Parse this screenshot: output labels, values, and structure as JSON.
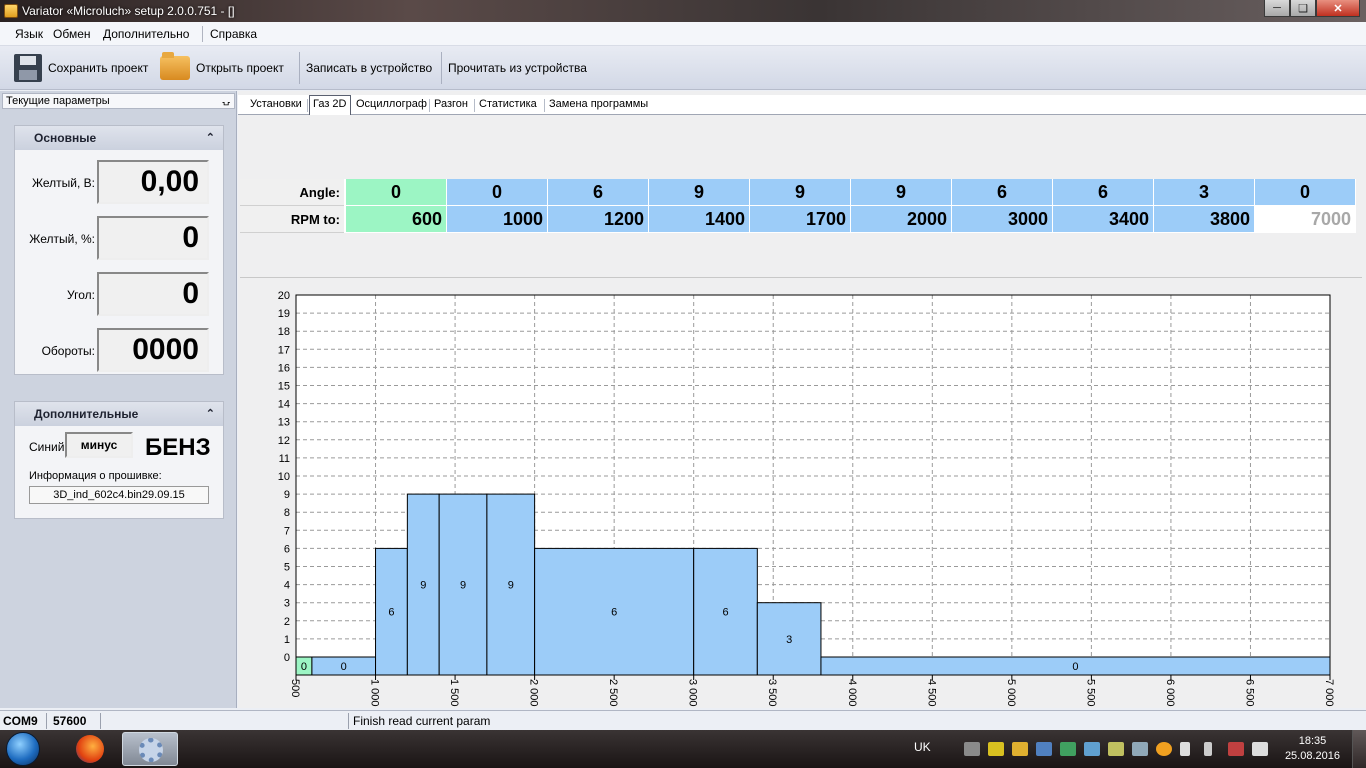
{
  "window": {
    "title": "Variator «Microluch» setup 2.0.0.751 - []"
  },
  "menu": [
    "Язык",
    "Обмен",
    "Дополнительно",
    "Справка"
  ],
  "toolbar": {
    "save": "Сохранить проект",
    "open": "Открыть проект",
    "write": "Записать в устройство",
    "read": "Прочитать из устройства"
  },
  "left_panel": {
    "title": "Текущие параметры",
    "main": {
      "title": "Основные",
      "rows": [
        {
          "label": "Желтый, В:",
          "value": "0,00"
        },
        {
          "label": "Желтый, %:",
          "value": "0"
        },
        {
          "label": "Угол:",
          "value": "0"
        },
        {
          "label": "Обороты:",
          "value": "0000"
        }
      ]
    },
    "extra": {
      "title": "Дополнительные",
      "blue_label": "Синий:",
      "blue_value": "минус",
      "fuel": "БЕНЗ",
      "fw_label": "Информация о прошивке:",
      "fw_value": "3D_ind_602c4.bin29.09.15"
    }
  },
  "tabs": [
    "Установки",
    "Газ 2D",
    "Осциллограф",
    "Разгон",
    "Статистика",
    "Замена программы"
  ],
  "active_tab": 1,
  "table": {
    "angle_label": "Angle:",
    "rpm_label": "RPM to:",
    "angle": [
      "0",
      "0",
      "6",
      "9",
      "9",
      "9",
      "6",
      "6",
      "3",
      "0"
    ],
    "rpm": [
      "600",
      "1000",
      "1200",
      "1400",
      "1700",
      "2000",
      "3000",
      "3400",
      "3800",
      "7000"
    ]
  },
  "chart_data": {
    "type": "bar",
    "x_ticks": [
      "500",
      "1 000",
      "1 500",
      "2 000",
      "2 500",
      "3 000",
      "3 500",
      "4 000",
      "4 500",
      "5 000",
      "5 500",
      "6 000",
      "6 500",
      "7 000"
    ],
    "xlim": [
      500,
      7000
    ],
    "ylim": [
      0,
      20
    ],
    "y_ticks": [
      "0",
      "1",
      "2",
      "3",
      "4",
      "5",
      "6",
      "7",
      "8",
      "9",
      "10",
      "11",
      "12",
      "13",
      "14",
      "15",
      "16",
      "17",
      "18",
      "19",
      "20"
    ],
    "bins": [
      {
        "from": 500,
        "to": 600,
        "value": 0,
        "label": "0"
      },
      {
        "from": 600,
        "to": 1000,
        "value": 0,
        "label": "0"
      },
      {
        "from": 1000,
        "to": 1200,
        "value": 6,
        "label": "6"
      },
      {
        "from": 1200,
        "to": 1400,
        "value": 9,
        "label": "9"
      },
      {
        "from": 1400,
        "to": 1700,
        "value": 9,
        "label": "9"
      },
      {
        "from": 1700,
        "to": 2000,
        "value": 9,
        "label": "9"
      },
      {
        "from": 2000,
        "to": 3000,
        "value": 6,
        "label": "6"
      },
      {
        "from": 3000,
        "to": 3400,
        "value": 6,
        "label": "6"
      },
      {
        "from": 3400,
        "to": 3800,
        "value": 3,
        "label": "3"
      },
      {
        "from": 3800,
        "to": 7000,
        "value": 0,
        "label": "0"
      }
    ],
    "grid": true,
    "colors": {
      "bar": "#9cccf8",
      "first_bar": "#9cf5c4"
    }
  },
  "status": {
    "port": "COM9",
    "baud": "57600",
    "message": "Finish read current param"
  },
  "taskbar": {
    "lang": "UK",
    "time": "18:35",
    "date": "25.08.2016"
  }
}
